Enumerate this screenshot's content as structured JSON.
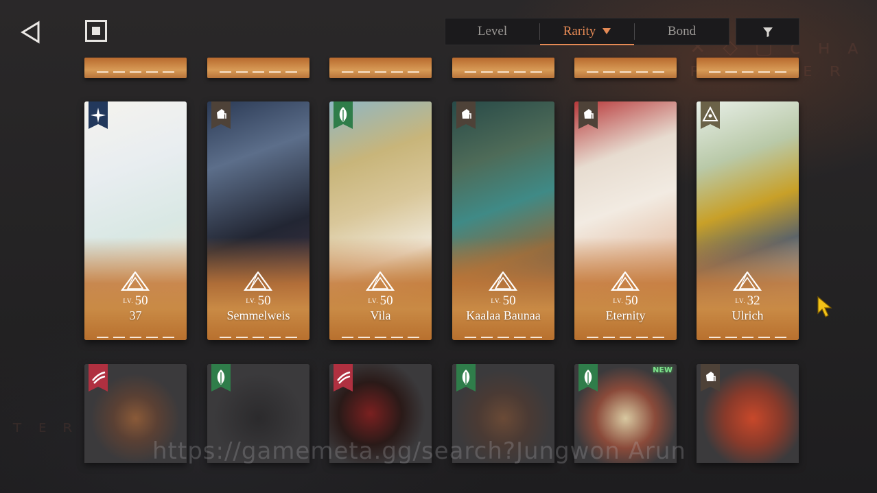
{
  "nav": {
    "back_icon": "back-arrow-icon",
    "stop_icon": "stop-square-icon"
  },
  "sort": {
    "tabs": [
      {
        "label": "Level",
        "active": false
      },
      {
        "label": "Rarity",
        "active": true
      },
      {
        "label": "Bond",
        "active": false
      }
    ],
    "filter_icon": "filter-funnel-icon",
    "accent": "#e58a55"
  },
  "cards": [
    {
      "level_prefix": "LV.",
      "level": "50",
      "name": "37",
      "class_icon": "star-compass-icon",
      "badge_color": "#22385c"
    },
    {
      "level_prefix": "LV.",
      "level": "50",
      "name": "Semmelweis",
      "class_icon": "fist-icon",
      "badge_color": "#4e4238"
    },
    {
      "level_prefix": "LV.",
      "level": "50",
      "name": "Vila",
      "class_icon": "leaf-icon",
      "badge_color": "#2f7d4a"
    },
    {
      "level_prefix": "LV.",
      "level": "50",
      "name": "Kaalaa Baunaa",
      "class_icon": "fist-icon",
      "badge_color": "#4e4238"
    },
    {
      "level_prefix": "LV.",
      "level": "50",
      "name": "Eternity",
      "class_icon": "fist-icon",
      "badge_color": "#4e4238"
    },
    {
      "level_prefix": "LV.",
      "level": "32",
      "name": "Ulrich",
      "class_icon": "pyramid-eye-icon",
      "badge_color": "#6b6248"
    }
  ],
  "bottom_cards": [
    {
      "class_icon": "claw-icon",
      "badge_color": "#b03040",
      "new": ""
    },
    {
      "class_icon": "leaf-icon",
      "badge_color": "#2f7d4a",
      "new": ""
    },
    {
      "class_icon": "claw-icon",
      "badge_color": "#b03040",
      "new": ""
    },
    {
      "class_icon": "leaf-icon",
      "badge_color": "#2f7d4a",
      "new": ""
    },
    {
      "class_icon": "leaf-icon",
      "badge_color": "#2f7d4a",
      "new": "NEW"
    },
    {
      "class_icon": "fist-icon",
      "badge_color": "#4e4238",
      "new": ""
    }
  ],
  "watermark": "https://gamemeta.gg/search?Jungwon Arun"
}
